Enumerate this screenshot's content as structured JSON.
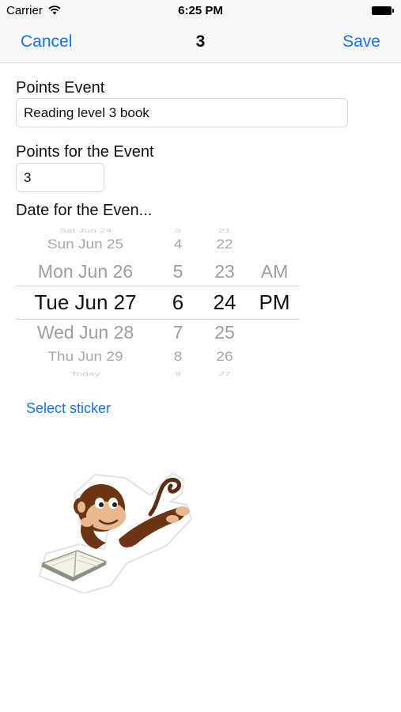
{
  "status_bar": {
    "carrier": "Carrier",
    "time": "6:25 PM"
  },
  "nav": {
    "cancel": "Cancel",
    "title": "3",
    "save": "Save"
  },
  "form": {
    "points_event_label": "Points Event",
    "points_event_value": "Reading level 3 book",
    "points_label": "Points for the Event",
    "points_value": "3",
    "date_label": "Date for the Even..."
  },
  "picker": {
    "dates": [
      "Sat Jun 24",
      "Sun Jun 25",
      "Mon Jun 26",
      "Tue Jun 27",
      "Wed Jun 28",
      "Thu Jun 29",
      "Today"
    ],
    "hours": [
      "3",
      "4",
      "5",
      "6",
      "7",
      "8",
      "9"
    ],
    "minutes": [
      "21",
      "22",
      "23",
      "24",
      "25",
      "26",
      "27"
    ],
    "ampm": [
      "AM",
      "PM"
    ],
    "selected": {
      "date": "Tue Jun 27",
      "hour": "6",
      "minute": "24",
      "ampm": "PM"
    }
  },
  "sticker": {
    "button": "Select sticker",
    "image": "monkey-reading-book"
  },
  "colors": {
    "accent": "#1a73e8",
    "bar_bg": "#f7f7f7"
  }
}
